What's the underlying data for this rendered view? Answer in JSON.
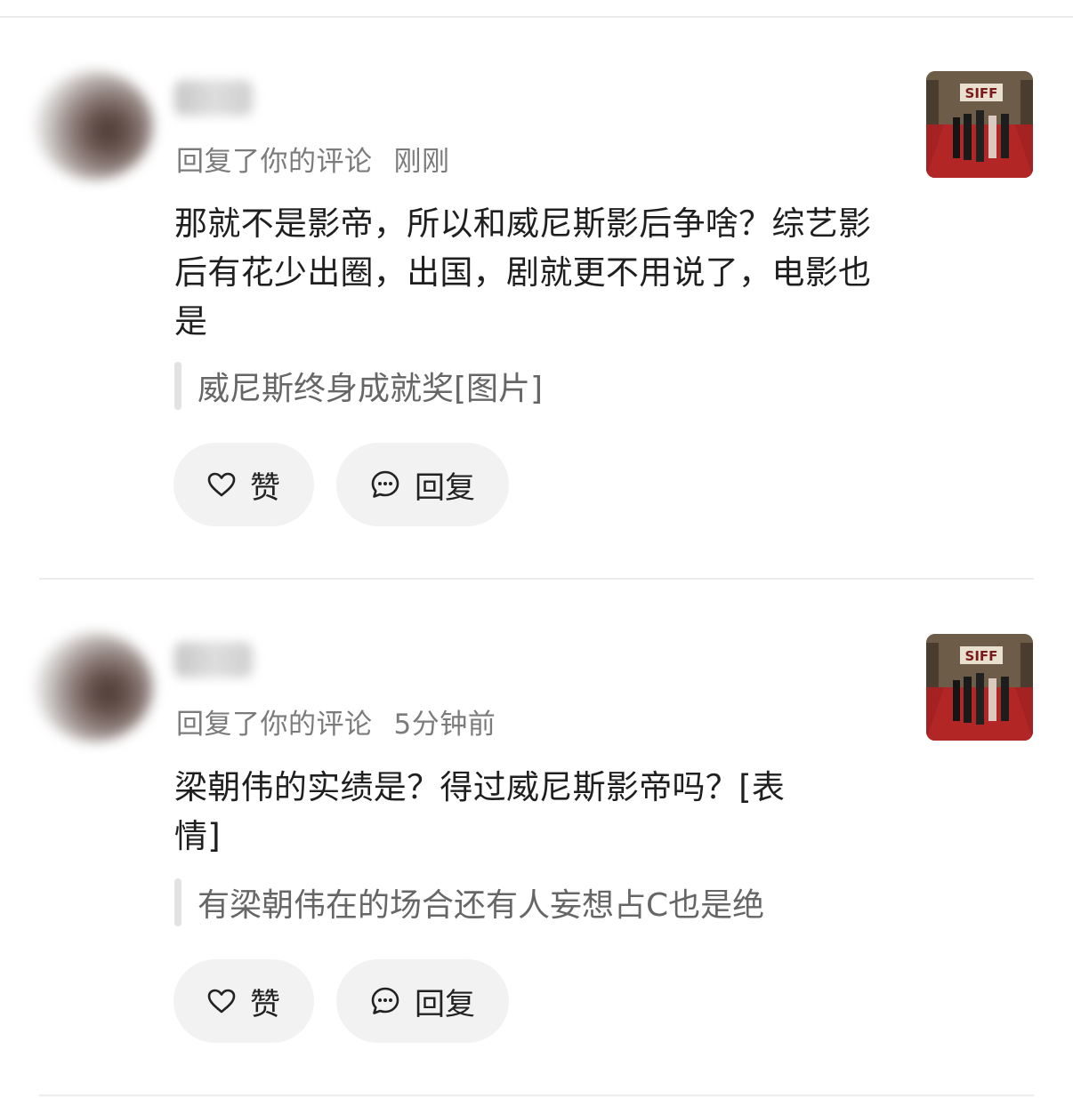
{
  "notifications": [
    {
      "meta_action": "回复了你的评论",
      "meta_time": "刚刚",
      "text": "那就不是影帝，所以和威尼斯影后争啥？综艺影后有花少出圈，出国，剧就更不用说了，电影也是",
      "quote": "威尼斯终身成就奖[图片]",
      "like_label": "赞",
      "reply_label": "回复",
      "thumb_text": "SIFF"
    },
    {
      "meta_action": "回复了你的评论",
      "meta_time": "5分钟前",
      "text": "梁朝伟的实绩是？得过威尼斯影帝吗？[表情]",
      "quote": "有梁朝伟在的场合还有人妄想占C也是绝",
      "like_label": "赞",
      "reply_label": "回复",
      "thumb_text": "SIFF"
    }
  ],
  "icons": {
    "like": "heart-icon",
    "reply": "comment-bubble-icon"
  },
  "colors": {
    "meta_text": "#7b7b7b",
    "quote_text": "#666666",
    "button_bg": "#f2f2f2",
    "divider": "#ececec",
    "carpet_red": "#a72424"
  }
}
